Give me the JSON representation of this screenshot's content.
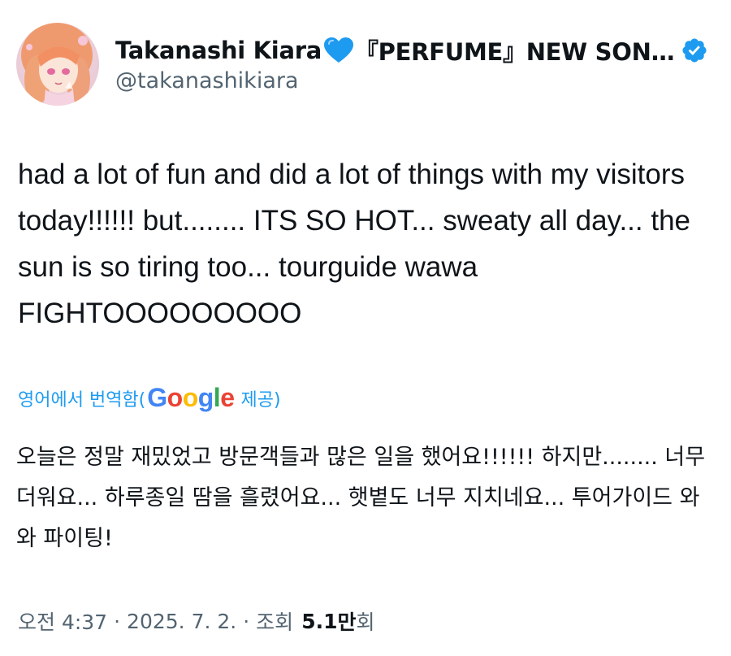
{
  "author": {
    "display_name": "Takanashi Kiara",
    "name_suffix": "『PERFUME』NEW SON…",
    "handle": "@takanashikiara",
    "verified": true,
    "heart_color": "#1d9bf0",
    "verified_color": "#1d9bf0"
  },
  "tweet": {
    "text": "had a lot of fun and did a lot of things with my visitors today!!!!!! but........ ITS SO HOT... sweaty all day... the sun is so tiring too... tourguide wawa FIGHTOOOOOOOOO",
    "translate_label": "영어에서 번역함(",
    "google_letters": [
      "G",
      "o",
      "o",
      "g",
      "l",
      "e"
    ],
    "provided_label": "제공)",
    "translated_text": "오늘은 정말 재밌었고 방문객들과 많은 일을 했어요!!!!!! 하지만........ 너무 더워요... 하루종일 땀을 흘렸어요... 햇볕도 너무 지치네요... 투어가이드 와와 파이팅!"
  },
  "meta": {
    "time": "오전 4:37",
    "separator": "·",
    "date": "2025. 7. 2.",
    "views_label": "조회",
    "views_count": "5.1",
    "views_unit": "만",
    "views_suffix": "회"
  },
  "colors": {
    "link": "#1d9bf0",
    "secondary_text": "#536471",
    "primary_text": "#0f1419"
  }
}
